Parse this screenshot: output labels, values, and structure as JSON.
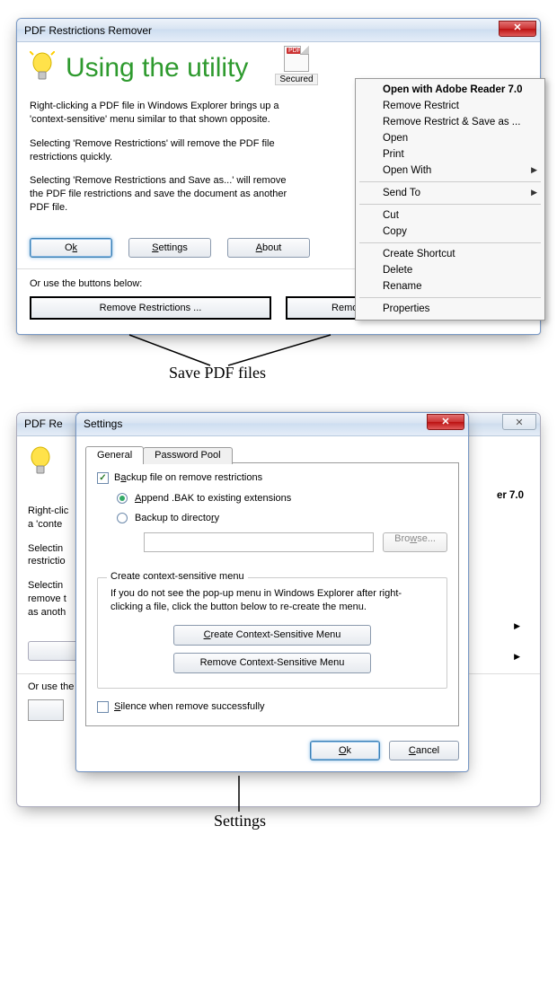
{
  "win1": {
    "title": "PDF Restrictions Remover",
    "heading": "Using the utility",
    "secured_label": "Secured",
    "para1": "Right-clicking a PDF file in Windows Explorer brings up a 'context-sensitive' menu similar to that shown opposite.",
    "para2": "Selecting 'Remove Restrictions' will remove the PDF file restrictions quickly.",
    "para3": "Selecting 'Remove Restrictions and Save as...' will remove the PDF file restrictions and save the document as another PDF file.",
    "btn_ok_pre": "O",
    "btn_ok_ul": "k",
    "btn_settings_ul": "S",
    "btn_settings_post": "ettings",
    "btn_about_ul": "A",
    "btn_about_post": "bout",
    "or_text": "Or use the buttons below:",
    "bigbtn1": "Remove Restrictions ...",
    "bigbtn2": "Remove Restrictions & Save as ..."
  },
  "ctx": {
    "open_reader": "Open with Adobe Reader 7.0",
    "remove_restrict": "Remove Restrict",
    "remove_save": "Remove Restrict & Save as ...",
    "open": "Open",
    "print": "Print",
    "open_with": "Open With",
    "send_to": "Send To",
    "cut": "Cut",
    "copy": "Copy",
    "create_shortcut": "Create Shortcut",
    "delete": "Delete",
    "rename": "Rename",
    "properties": "Properties"
  },
  "ann1": "Save PDF files",
  "win2": {
    "bg_title_fragment": "PDF Re",
    "bg_reader_fragment": "er 7.0",
    "bg_p1a": "Right-clic",
    "bg_p1b": "a 'conte",
    "bg_p2a": "Selectin",
    "bg_p2b": "restrictio",
    "bg_p3a": "Selectin",
    "bg_p3b": "remove t",
    "bg_p3c": "as anoth",
    "bg_or": "Or use the"
  },
  "settings": {
    "title": "Settings",
    "tab_general": "General",
    "tab_pwpool": "Password Pool",
    "chk_backup_pre": "B",
    "chk_backup_ul": "a",
    "chk_backup_post": "ckup file on remove restrictions",
    "rad_append_ul": "A",
    "rad_append_post": "ppend .BAK to existing extensions",
    "rad_backup_pre": "Backup to directo",
    "rad_backup_ul": "r",
    "rad_backup_post": "y",
    "browse_pre": "Bro",
    "browse_ul": "w",
    "browse_post": "se...",
    "group_legend": "Create context-sensitive menu",
    "group_text": "If you do not see the pop-up menu in Windows Explorer after right-clicking a file, click the button below to re-create the menu.",
    "btn_create_ul": "C",
    "btn_create_post": "reate Context-Sensitive Menu",
    "btn_remove": "Remove Context-Sensitive Menu",
    "chk_silence_ul": "S",
    "chk_silence_post": "ilence when remove successfully",
    "btn_ok_ul": "O",
    "btn_ok_post": "k",
    "btn_cancel_ul": "C",
    "btn_cancel_post": "ancel"
  },
  "ann2": "Settings"
}
